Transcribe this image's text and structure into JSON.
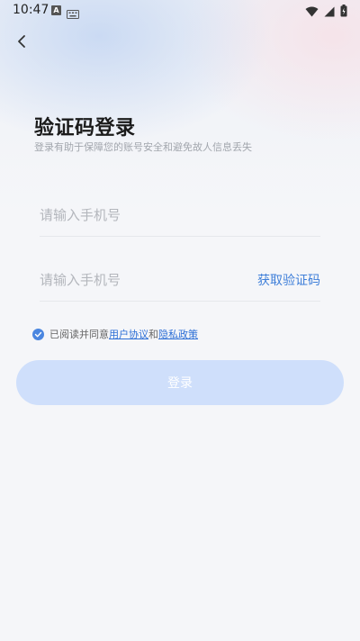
{
  "status_bar": {
    "time": "10:47",
    "icon_a_letter": "A"
  },
  "header": {
    "back_icon": "chevron-left-icon"
  },
  "login": {
    "title": "验证码登录",
    "subtitle": "登录有助于保障您的账号安全和避免故人信息丢失",
    "phone_placeholder": "请输入手机号",
    "code_placeholder": "请输入手机号",
    "get_code_label": "获取验证码",
    "agreement": {
      "checked": true,
      "prefix": "已阅读并同意",
      "user_agreement": "用户协议",
      "and": "和",
      "privacy_policy": "隐私政策"
    },
    "submit_label": "登录"
  },
  "colors": {
    "accent": "#3f7fd9",
    "button_disabled": "#cfdffb",
    "background": "#f5f6f9"
  }
}
